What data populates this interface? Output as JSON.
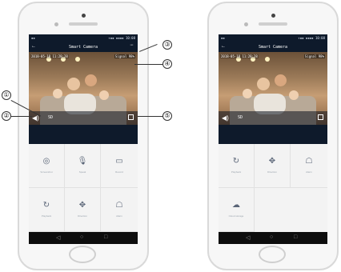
{
  "app": {
    "title": "Smart Camera",
    "status_left": "▪▪ ",
    "status_right": "▾▪▪ ▪▪▪▪ 10:08",
    "timestamp": "2018-05-18 11:28:28",
    "signal": "Signal 98%",
    "sd_label": "SD",
    "back_glyph": "←",
    "more_glyph": "···",
    "volume_glyph": "◀)"
  },
  "left_functions": [
    {
      "label": "Screenshot",
      "icon": "camera-icon",
      "glyph": "◎"
    },
    {
      "label": "Speak",
      "icon": "microphone-icon",
      "glyph": "🎙"
    },
    {
      "label": "Record",
      "icon": "video-icon",
      "glyph": "▭"
    },
    {
      "label": "Playback",
      "icon": "playback-icon",
      "glyph": "↻"
    },
    {
      "label": "Direction",
      "icon": "direction-icon",
      "glyph": "✥"
    },
    {
      "label": "Alarm",
      "icon": "alarm-icon",
      "glyph": "☖"
    }
  ],
  "right_functions": [
    {
      "label": "Playback",
      "icon": "playback-icon",
      "glyph": "↻"
    },
    {
      "label": "Direction",
      "icon": "direction-icon",
      "glyph": "✥"
    },
    {
      "label": "Alarm",
      "icon": "alarm-icon",
      "glyph": "☖"
    },
    {
      "label": "Cloud storage",
      "icon": "cloud-icon",
      "glyph": "☁"
    }
  ],
  "navbar": {
    "back": "◁",
    "home": "○",
    "recent": "□"
  },
  "callouts": [
    "①",
    "②",
    "③",
    "④",
    "⑤"
  ]
}
